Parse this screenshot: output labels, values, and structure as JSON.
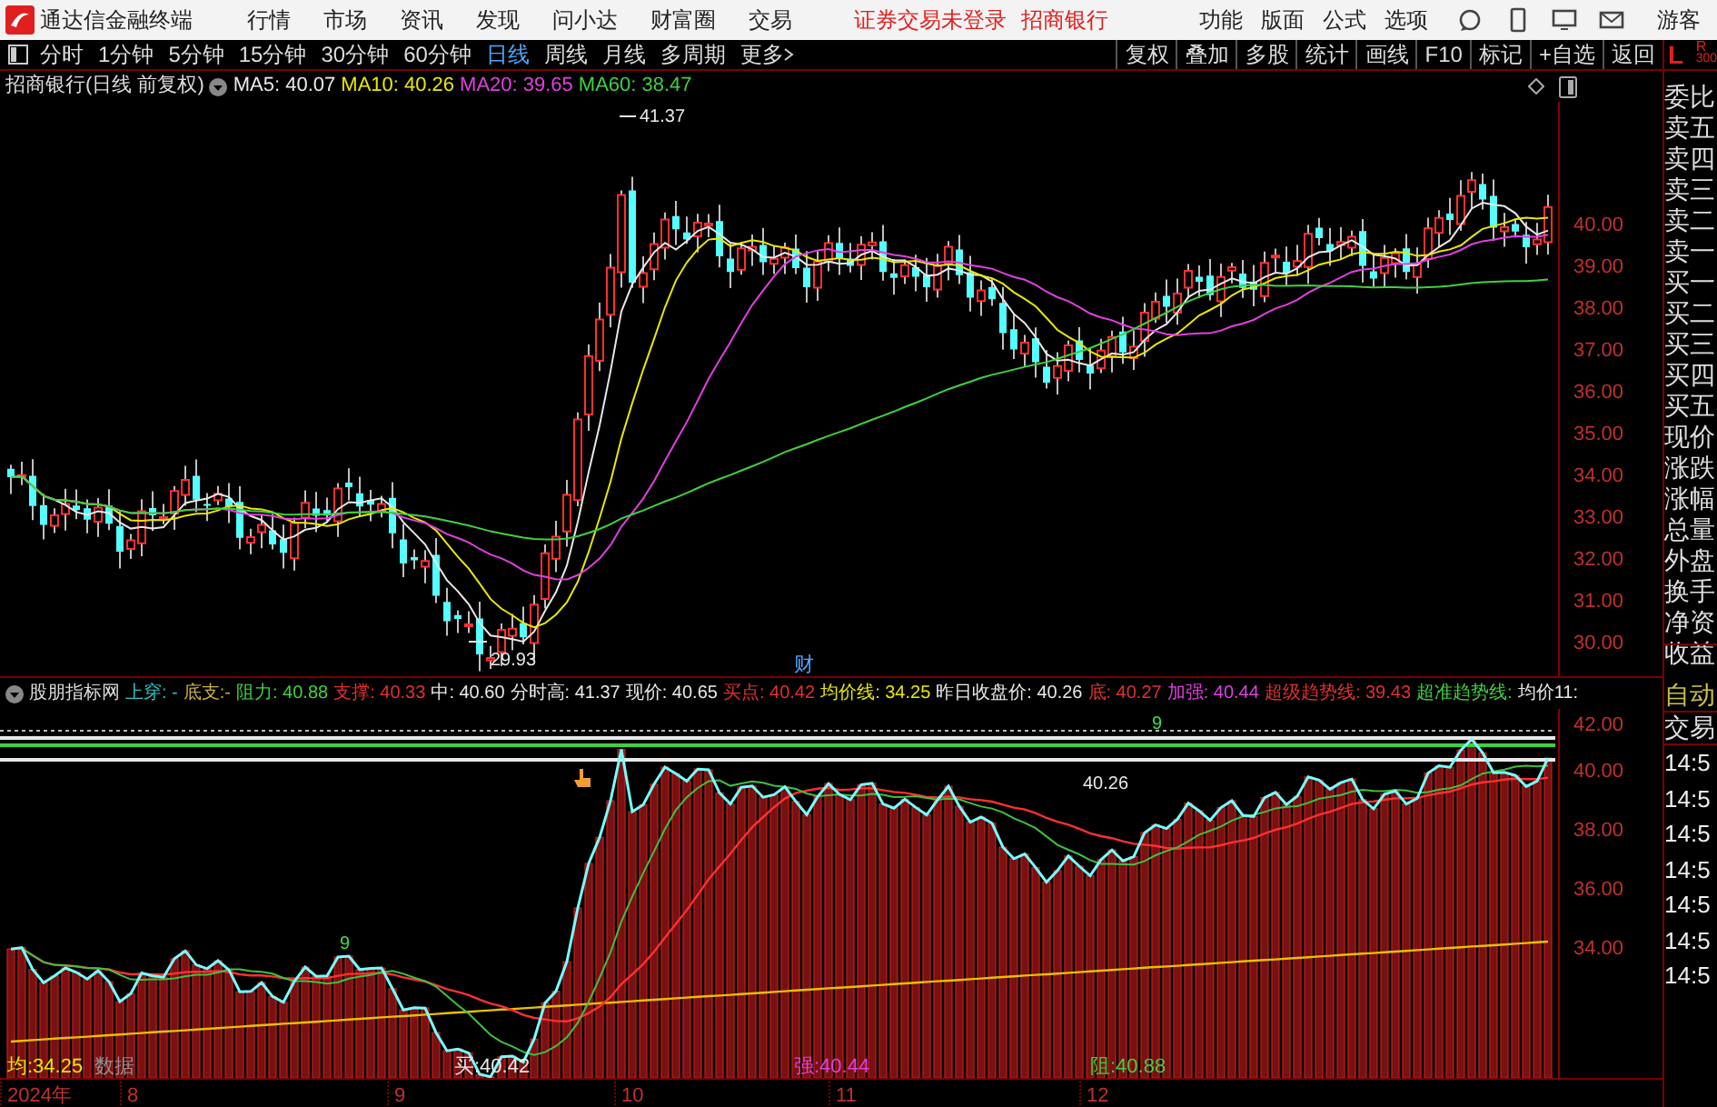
{
  "top_menu": {
    "app_title": "通达信金融终端",
    "menus": [
      "行情",
      "市场",
      "资讯",
      "发现",
      "问小达",
      "财富圈",
      "交易"
    ],
    "status": [
      "证券交易未登录",
      "招商银行"
    ],
    "tools": [
      "功能",
      "版面",
      "公式",
      "选项"
    ],
    "user": "游客"
  },
  "toolbar": {
    "periods": [
      {
        "label": "分时",
        "selected": false
      },
      {
        "label": "1分钟",
        "selected": false
      },
      {
        "label": "5分钟",
        "selected": false
      },
      {
        "label": "15分钟",
        "selected": false
      },
      {
        "label": "30分钟",
        "selected": false
      },
      {
        "label": "60分钟",
        "selected": false
      },
      {
        "label": "日线",
        "selected": true
      },
      {
        "label": "周线",
        "selected": false
      },
      {
        "label": "月线",
        "selected": false
      },
      {
        "label": "多周期",
        "selected": false
      }
    ],
    "more": "更多",
    "actions": [
      "复权",
      "叠加",
      "多股",
      "统计",
      "画线",
      "F10",
      "标记",
      "+自选",
      "返回"
    ],
    "corner": {
      "left": "L",
      "right": "R",
      "count": "300"
    }
  },
  "chart_header": {
    "title": "招商银行(日线 前复权)",
    "indicators": [
      {
        "label": "MA5: 40.07",
        "color": "#e8e8e8"
      },
      {
        "label": "MA10: 40.26",
        "color": "#e8e800"
      },
      {
        "label": "MA20: 39.65",
        "color": "#e040e0"
      },
      {
        "label": "MA60: 38.47",
        "color": "#40d040"
      }
    ]
  },
  "price_chart": {
    "yticks": [
      "40.00",
      "39.00",
      "38.00",
      "37.00",
      "36.00",
      "35.00",
      "34.00",
      "33.00",
      "32.00",
      "31.00",
      "30.00"
    ],
    "high_label": "41.37",
    "low_label": "29.93",
    "event_marker": "财"
  },
  "indicator_header": {
    "title": "股朋指标网",
    "items": [
      {
        "text": "上穿: -",
        "color": "#30c0c0"
      },
      {
        "text": "底支:-",
        "color": "#c8b040"
      },
      {
        "text": "阻力: 40.88",
        "color": "#40d040"
      },
      {
        "text": "支撑: 40.33",
        "color": "#e03030"
      },
      {
        "text": "中: 40.60",
        "color": "#e8e8e8"
      },
      {
        "text": "分时高: 41.37",
        "color": "#e8e8e8"
      },
      {
        "text": "现价: 40.65",
        "color": "#e8e8e8"
      },
      {
        "text": "买点: 40.42",
        "color": "#e03030"
      },
      {
        "text": "均价线: 34.25",
        "color": "#e8e800"
      },
      {
        "text": "昨日收盘价: 40.26",
        "color": "#e8e8e8"
      },
      {
        "text": "底: 40.27",
        "color": "#e03030"
      },
      {
        "text": "加强: 40.44",
        "color": "#e040e0"
      },
      {
        "text": "超级趋势线: 39.43",
        "color": "#e03030"
      },
      {
        "text": "超准趋势线:",
        "color": "#40d040"
      },
      {
        "text": "均价11:",
        "color": "#e8e8e8"
      }
    ]
  },
  "indicator_chart": {
    "yticks": [
      "42.00",
      "40.00",
      "38.00",
      "36.00",
      "34.00"
    ],
    "labels": [
      {
        "text": "40.26",
        "color": "#e8e8e8"
      },
      {
        "text": "9",
        "color": "#40e040"
      },
      {
        "text": "9",
        "color": "#40e040"
      }
    ],
    "bottom_labels": [
      {
        "text": "均:34.25",
        "color": "#e8e800"
      },
      {
        "text": "数据",
        "color": "#909090"
      },
      {
        "text": "买:40.42",
        "color": "#e8e8e8"
      },
      {
        "text": "强:40.44",
        "color": "#e040e0"
      },
      {
        "text": "阻:40.88",
        "color": "#40d040"
      }
    ]
  },
  "date_axis": [
    "2024年",
    "8",
    "9",
    "10",
    "11",
    "12"
  ],
  "quote_panel": {
    "fields": [
      "委比",
      "卖五",
      "卖四",
      "卖三",
      "卖二",
      "卖一",
      "买一",
      "买二",
      "买三",
      "买四",
      "买五",
      "现价",
      "涨跌",
      "涨幅",
      "总量",
      "外盘",
      "换手",
      "净资",
      "收益"
    ],
    "trade_tabs": [
      "自动",
      "交易"
    ],
    "ticks": [
      "14:5",
      "14:5",
      "14:5",
      "14:5",
      "14:5",
      "14:5",
      "14:5"
    ]
  }
}
